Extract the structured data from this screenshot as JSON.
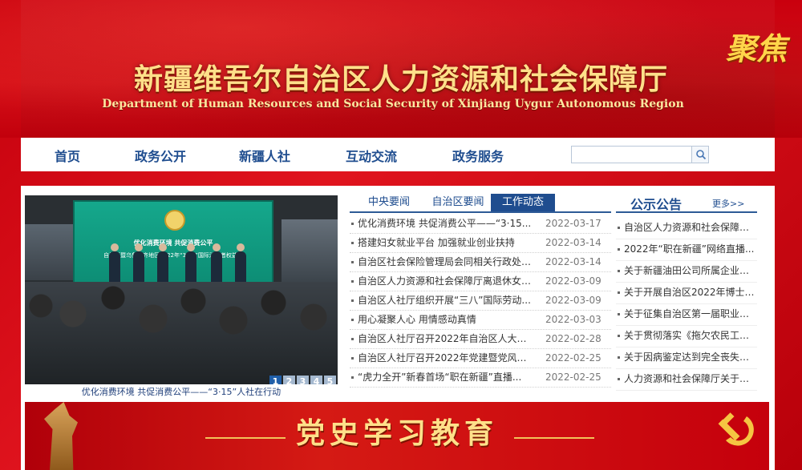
{
  "header": {
    "title": "新疆维吾尔自治区人力资源和社会保障厅",
    "subtitle": "Department of Human Resources and Social Security of Xinjiang Uygur Autonomous Region",
    "slogan": "聚焦"
  },
  "nav": {
    "items": [
      "首页",
      "政务公开",
      "新疆人社",
      "互动交流",
      "政务服务"
    ],
    "search_value": ""
  },
  "slider": {
    "stage_line1": "优化消费环境  共促消费公平",
    "stage_line2": "自治区暨乌鲁木齐地区2022年“3·15”国际消费者权益日",
    "pages": [
      "1",
      "2",
      "3",
      "4",
      "5"
    ],
    "active_page": "1",
    "caption": "优化消费环境 共促消费公平——“3·15”人社在行动"
  },
  "news": {
    "tabs": [
      "中央要闻",
      "自治区要闻",
      "工作动态"
    ],
    "active_tab": "工作动态",
    "items": [
      {
        "title": "优化消费环境 共促消费公平——“3·15...",
        "date": "2022-03-17"
      },
      {
        "title": "搭建妇女就业平台 加强就业创业扶持",
        "date": "2022-03-14"
      },
      {
        "title": "自治区社会保险管理局会同相关行政处室...",
        "date": "2022-03-14"
      },
      {
        "title": "自治区人力资源和社会保障厅离退休女同...",
        "date": "2022-03-09"
      },
      {
        "title": "自治区人社厅组织开展“三八”国际劳动...",
        "date": "2022-03-09"
      },
      {
        "title": "用心凝聚人心 用情感动真情",
        "date": "2022-03-03"
      },
      {
        "title": "自治区人社厅召开2022年自治区人大代...",
        "date": "2022-02-28"
      },
      {
        "title": "自治区人社厅召开2022年党建暨党风廉...",
        "date": "2022-02-25"
      },
      {
        "title": "“虎力全开”新春首场“职在新疆”直播...",
        "date": "2022-02-25"
      }
    ]
  },
  "notice": {
    "title": "公示公告",
    "more": "更多>>",
    "items": [
      "自治区人力资源和社会保障厅...",
      "2022年“职在新疆”网络直播...",
      "关于新疆油田公司所属企业第...",
      "关于开展自治区2022年博士后...",
      "关于征集自治区第一届职业技...",
      "关于贯彻落实《拖欠农民工工...",
      "关于因病鉴定达到完全丧失劳...",
      "人力资源和社会保障厅关于防..."
    ]
  },
  "party": {
    "text": "党史学习教育"
  },
  "colors": {
    "brand_red": "#d61018",
    "nav_blue": "#1f4d8f",
    "gold": "#ffe08a"
  }
}
